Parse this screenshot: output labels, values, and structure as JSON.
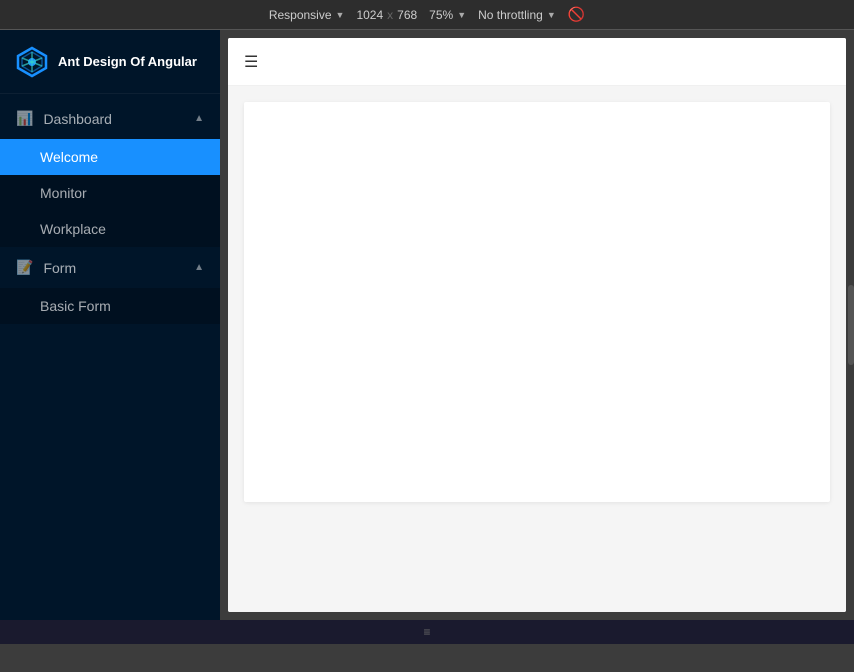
{
  "browser": {
    "responsive_label": "Responsive",
    "width": "1024",
    "x_separator": "x",
    "height": "768",
    "zoom_label": "75%",
    "throttle_label": "No throttling",
    "dropdown_symbol": "▼"
  },
  "sidebar": {
    "logo_text": "Ant Design Of Angular",
    "nav": [
      {
        "id": "dashboard",
        "label": "Dashboard",
        "icon": "📊",
        "expanded": true,
        "items": [
          {
            "id": "welcome",
            "label": "Welcome",
            "active": true
          },
          {
            "id": "monitor",
            "label": "Monitor",
            "active": false
          },
          {
            "id": "workplace",
            "label": "Workplace",
            "active": false
          }
        ]
      },
      {
        "id": "form",
        "label": "Form",
        "icon": "📝",
        "expanded": true,
        "items": [
          {
            "id": "basic-form",
            "label": "Basic Form",
            "active": false
          }
        ]
      }
    ]
  },
  "preview": {
    "menu_toggle_title": "Toggle Menu",
    "content_placeholder": ""
  },
  "status_bar": {
    "icon": "≡"
  }
}
